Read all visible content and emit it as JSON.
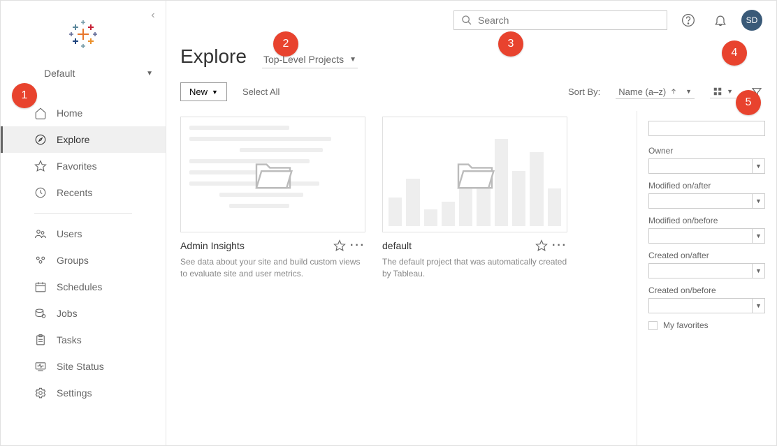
{
  "site": {
    "name": "Default"
  },
  "nav": {
    "home": "Home",
    "explore": "Explore",
    "favorites": "Favorites",
    "recents": "Recents",
    "users": "Users",
    "groups": "Groups",
    "schedules": "Schedules",
    "jobs": "Jobs",
    "tasks": "Tasks",
    "site_status": "Site Status",
    "settings": "Settings"
  },
  "header": {
    "search_placeholder": "Search",
    "avatar_initials": "SD"
  },
  "page": {
    "title": "Explore",
    "content_type": "Top-Level Projects"
  },
  "toolbar": {
    "new_label": "New",
    "select_all": "Select All",
    "sort_by_label": "Sort By:",
    "sort_value": "Name (a–z)"
  },
  "cards": [
    {
      "title": "Admin Insights",
      "description": "See data about your site and build custom views to evaluate site and user metrics."
    },
    {
      "title": "default",
      "description": "The default project that was automatically created by Tableau."
    }
  ],
  "filters": {
    "owner_label": "Owner",
    "modified_after_label": "Modified on/after",
    "modified_before_label": "Modified on/before",
    "created_after_label": "Created on/after",
    "created_before_label": "Created on/before",
    "my_favorites_label": "My favorites"
  },
  "badges": {
    "b1": "1",
    "b2": "2",
    "b3": "3",
    "b4": "4",
    "b5": "5"
  }
}
